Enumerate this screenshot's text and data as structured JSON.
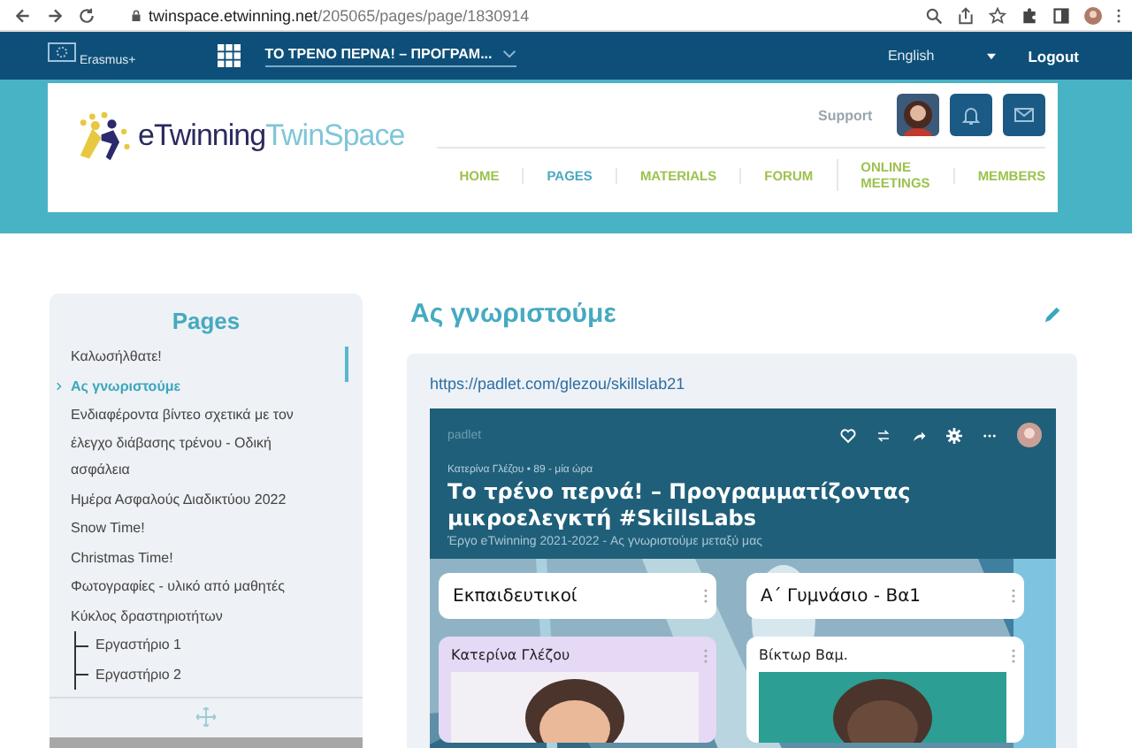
{
  "browser": {
    "url_host": "twinspace.etwinning.net",
    "url_path": "/205065/pages/page/1830914"
  },
  "topbar": {
    "brand": "Erasmus+",
    "project": "ΤΟ ΤΡΕΝΟ ΠΕΡΝΑ! – ΠΡΟΓΡΑΜ...",
    "language": "English",
    "logout": "Logout"
  },
  "header": {
    "logo_primary": "eTwinning",
    "logo_secondary": "TwinSpace",
    "support": "Support",
    "nav": [
      {
        "label": "HOME",
        "selected": false
      },
      {
        "label": "PAGES",
        "selected": true
      },
      {
        "label": "MATERIALS",
        "selected": false
      },
      {
        "label": "FORUM",
        "selected": false
      },
      {
        "label": "ONLINE MEETINGS",
        "selected": false
      },
      {
        "label": "MEMBERS",
        "selected": false
      }
    ]
  },
  "sidebar": {
    "title": "Pages",
    "items": [
      {
        "label": "Καλωσήλθατε!",
        "selected": false
      },
      {
        "label": "Ας γνωριστούμε",
        "selected": true
      },
      {
        "label": "Ενδιαφέροντα βίντεο σχετικά με τον έλεγχο διάβασης τρένου - Οδική ασφάλεια",
        "selected": false
      },
      {
        "label": "Ημέρα Ασφαλούς Διαδικτύου 2022",
        "selected": false
      },
      {
        "label": "Snow Time!",
        "selected": false
      },
      {
        "label": "Christmas Time!",
        "selected": false
      },
      {
        "label": "Φωτογραφίες - υλικό από μαθητές",
        "selected": false
      },
      {
        "label": "Κύκλος δραστηριοτήτων",
        "selected": false,
        "children": [
          {
            "label": "Εργαστήριο 1",
            "selected": false
          },
          {
            "label": "Εργαστήριο 2",
            "selected": false
          }
        ]
      }
    ]
  },
  "page": {
    "title": "Ας γνωριστούμε",
    "link": "https://padlet.com/glezou/skillslab21",
    "padlet": {
      "brand": "padlet",
      "meta": "Κατερίνα Γλέζου • 89 - μία ώρα",
      "title": "Το τρένο περνά! – Προγραμματίζοντας μικροελεγκτή #SkillsLabs",
      "subtitle": "Έργο eTwinning 2021-2022 - Ας γνωριστούμε μεταξύ μας",
      "columns": [
        {
          "title": "Εκπαιδευτικοί",
          "post": {
            "author": "Κατερίνα Γλέζου",
            "color": "#e6d9f5"
          }
        },
        {
          "title": "Α΄ Γυμνάσιο - Βα1",
          "post": {
            "author": "Βίκτωρ Βαμ.",
            "color": "#ffffff"
          }
        }
      ]
    }
  }
}
